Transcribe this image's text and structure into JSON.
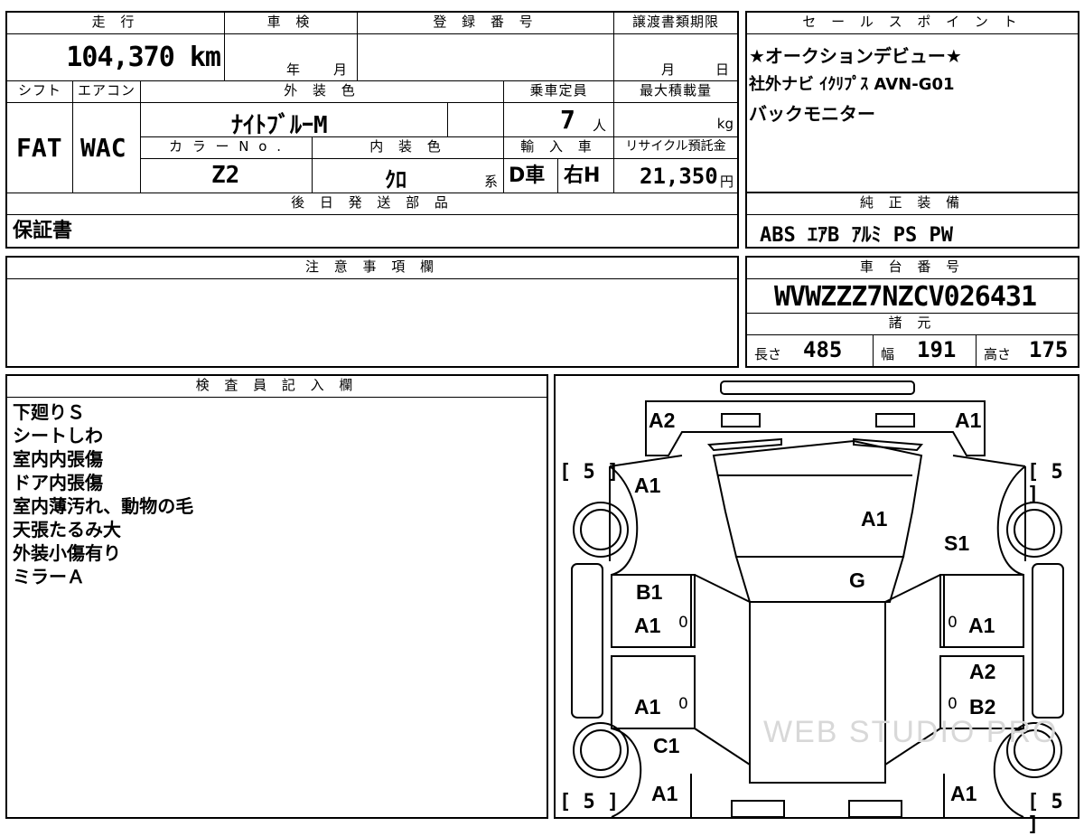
{
  "headers": {
    "mileage": "走 行",
    "shaken": "車 検",
    "reg_number": "登 録 番 号",
    "transfer_deadline": "譲渡書類期限",
    "shift": "シフト",
    "aircon": "エアコン",
    "exterior_color": "外 装 色",
    "capacity": "乗車定員",
    "max_load": "最大積載量",
    "color_no": "カ ラ ー N o .",
    "interior_color": "内 装 色",
    "import": "輸 入 車",
    "recycle": "リサイクル預託金",
    "later_parts": "後 日 発 送 部 品",
    "sales_point": "セ ー ル ス ポ イ ン ト",
    "standard_equipment": "純 正 装 備",
    "notes": "注 意 事 項 欄",
    "chassis": "車 台 番 号",
    "specs": "諸 元",
    "inspector": "検 査 員 記 入 欄"
  },
  "values": {
    "mileage": "104,370 km",
    "shaken_year_unit": "年",
    "shaken_month_unit": "月",
    "deadline_month_unit": "月",
    "deadline_day_unit": "日",
    "shift": "FAT",
    "aircon": "WAC",
    "exterior_color": "ﾅｲﾄﾌﾞﾙｰM",
    "capacity": "7",
    "capacity_unit": "人",
    "max_load_unit": "kg",
    "color_no": "Z2",
    "interior_color": "ｸﾛ",
    "interior_suffix": "系",
    "drive": "D車",
    "handle": "右H",
    "recycle": "21,350",
    "recycle_unit": "円",
    "later_parts": "保証書",
    "chassis": "WVWZZZ7NZCV026431",
    "length_label": "長さ",
    "length": "485",
    "width_label": "幅",
    "width": "191",
    "height_label": "高さ",
    "height": "175"
  },
  "sales_points": [
    "★オークションデビュー★",
    "社外ナビ ｲｸﾘﾌﾟｽ AVN-G01",
    "バックモニター"
  ],
  "equipment": "ABS ｴｱB ｱﾙﾐ PS PW",
  "inspector_notes": [
    "下廻りＳ",
    "シートしわ",
    "室内内張傷",
    "ドア内張傷",
    "室内薄汚れ、動物の毛",
    "天張たるみ大",
    "外装小傷有り",
    "ミラーＡ"
  ],
  "diagram": {
    "marks": {
      "front_left_corner": "A2",
      "front_right_corner": "A1",
      "left_fender": "A1",
      "hood": "A1",
      "right_fender": "S1",
      "windshield": "G",
      "left_front_door_1": "B1",
      "left_front_door_2": "A1",
      "right_front_door": "A1",
      "left_rear_door": "A1",
      "right_rear_door_1": "A2",
      "right_rear_door_2": "B2",
      "left_rear_fender": "C1",
      "left_rear_corner": "A1",
      "right_rear_corner": "A1",
      "tire_front_left": "5",
      "tire_front_right": "5",
      "tire_rear_left": "5",
      "tire_rear_right": "5",
      "door_zero_1": "0",
      "door_zero_2": "0",
      "door_zero_3": "0",
      "door_zero_4": "0"
    },
    "watermark": "WEB STUDIO PRO"
  }
}
